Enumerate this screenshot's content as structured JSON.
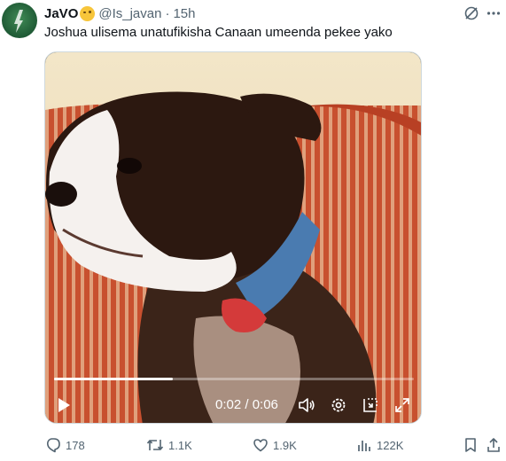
{
  "tweet": {
    "display_name": "JaVO",
    "handle": "@Is_javan",
    "separator": "·",
    "time": "15h",
    "text": "Joshua ulisema unatufikisha Canaan umeenda pekee yako"
  },
  "video": {
    "time_display": "0:02 / 0:06",
    "progress": 0.33
  },
  "actions": {
    "replies": "178",
    "reposts": "1.1K",
    "likes": "1.9K",
    "views": "122K"
  },
  "colors": {
    "text_primary": "#0f1419",
    "text_secondary": "#536471",
    "border": "#cfd9de"
  }
}
